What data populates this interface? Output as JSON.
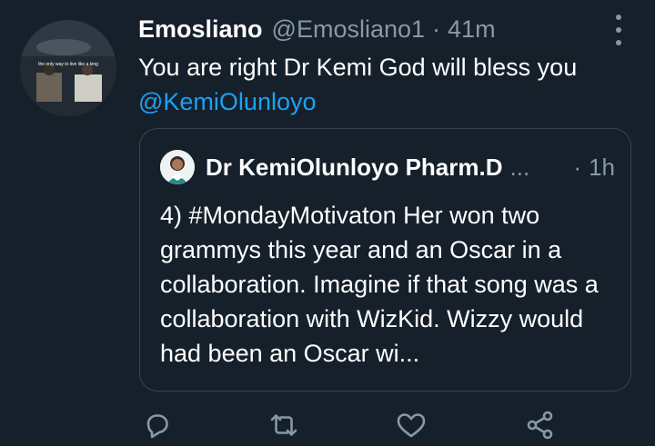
{
  "tweet": {
    "display_name": "Emosliano",
    "handle": "@Emosliano1",
    "separator": "·",
    "time": "41m",
    "text": "You are right Dr Kemi God will bless you",
    "mention": "@KemiOlunloyo",
    "avatar_caption": "the only way to live like a king",
    "quoted": {
      "display_name": "Dr KemiOlunloyo Pharm.D",
      "ellipsis": "...",
      "separator": "·",
      "time": "1h",
      "text": "4) #MondayMotivaton Her won two grammys this year and an Oscar in a collaboration. Imagine if that song was a collaboration with WizKid. Wizzy would had been an Oscar wi..."
    }
  },
  "actions": [
    {
      "name": "reply",
      "icon": "reply-icon"
    },
    {
      "name": "retweet",
      "icon": "retweet-icon"
    },
    {
      "name": "like",
      "icon": "heart-icon"
    },
    {
      "name": "share",
      "icon": "share-icon"
    }
  ],
  "colors": {
    "background": "#15202b",
    "secondary_text": "#8899a6",
    "link": "#1da1f2",
    "border": "#38444d"
  }
}
